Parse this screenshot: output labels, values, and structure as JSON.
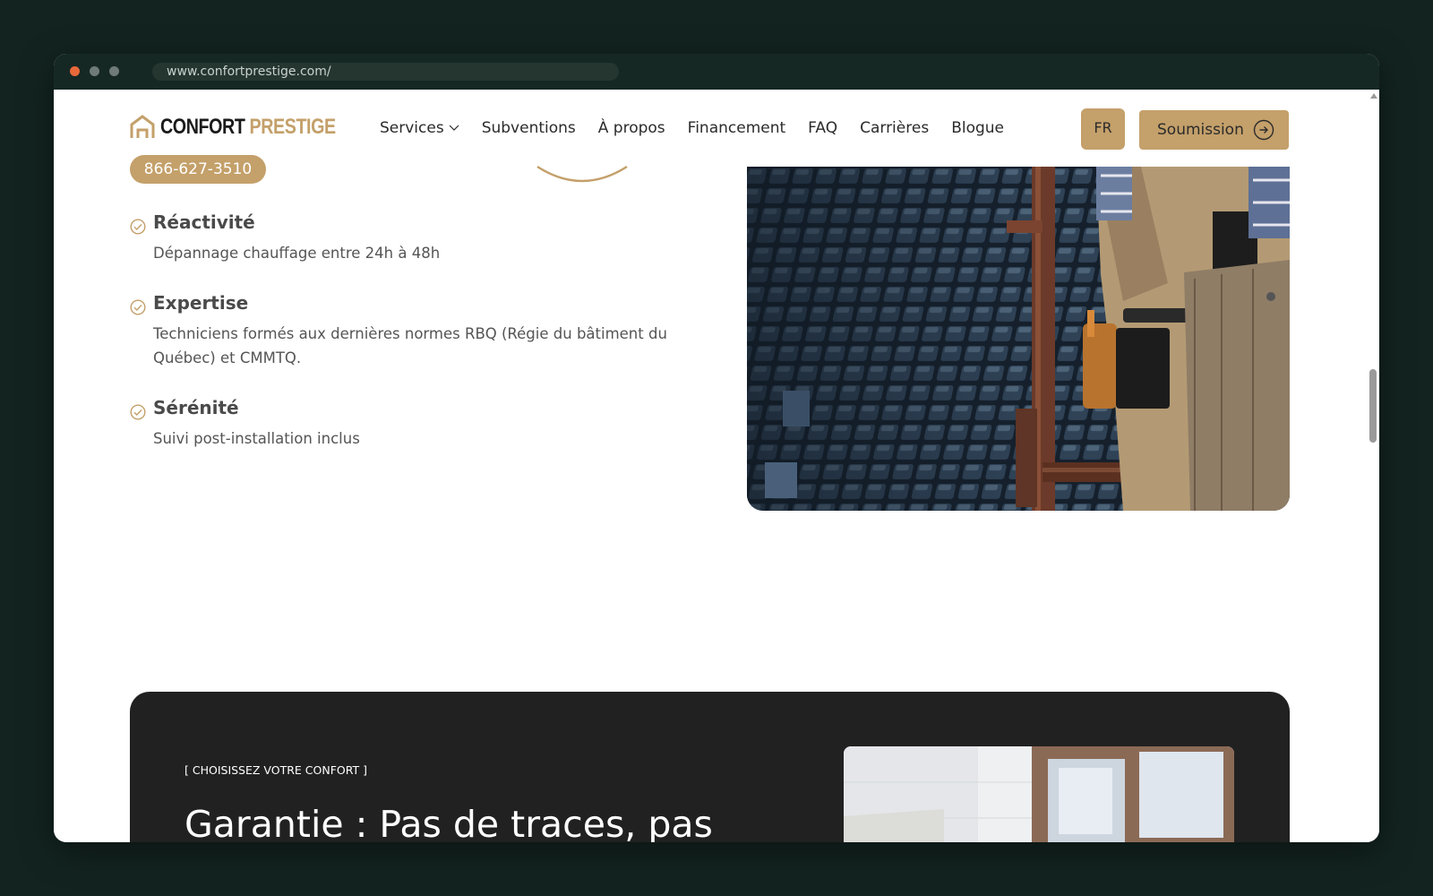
{
  "browser": {
    "url": "www.confortprestige.com/"
  },
  "header": {
    "logo": {
      "part1": "CONFORT",
      "part2": "PRESTIGE"
    },
    "phone": "866-627-3510",
    "nav": [
      "Services",
      "Subventions",
      "À propos",
      "Financement",
      "FAQ",
      "Carrières",
      "Blogue"
    ],
    "lang_label": "FR",
    "cta_label": "Soumission"
  },
  "features": [
    {
      "title": "Réactivité",
      "desc": "Dépannage chauffage entre 24h à 48h"
    },
    {
      "title": "Expertise",
      "desc": "Techniciens formés aux dernières normes RBQ (Régie du bâtiment du Québec) et CMMTQ."
    },
    {
      "title": "Sérénité",
      "desc": "Suivi post-installation inclus"
    }
  ],
  "promo": {
    "eyebrow": "[ CHOISISSEZ VOTRE CONFORT ]",
    "headline": "Garantie : Pas de traces, pas de stress – seulement des"
  },
  "colors": {
    "accent": "#c4a06a",
    "dark": "#212121",
    "frame": "#132420"
  },
  "icons": {
    "check": "check-circle-icon",
    "chevron": "chevron-down-icon",
    "arrow": "arrow-right-circle-icon"
  }
}
